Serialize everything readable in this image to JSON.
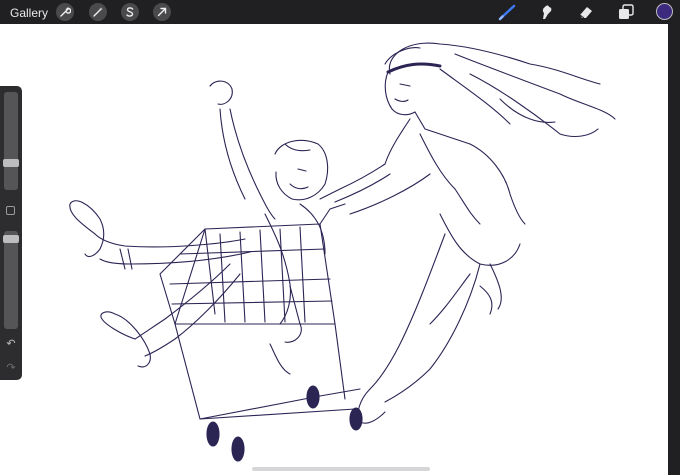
{
  "topbar": {
    "gallery_label": "Gallery",
    "left_tools": [
      "wrench-icon",
      "magic-wand-icon",
      "selection-s-icon",
      "transform-arrow-icon"
    ],
    "right_tools": [
      "brush-icon",
      "smudge-icon",
      "eraser-icon",
      "layers-icon"
    ],
    "active_tool": "brush-icon",
    "current_color": "#3b2a7d",
    "accent_color": "#3d7bf7"
  },
  "sidebar": {
    "brush_size_level": 0.5,
    "opacity_level": 0.9,
    "undo_icon": "undo-icon",
    "redo_icon": "redo-icon"
  },
  "canvas": {
    "background": "#ffffff",
    "stroke_color": "#2b2554"
  }
}
